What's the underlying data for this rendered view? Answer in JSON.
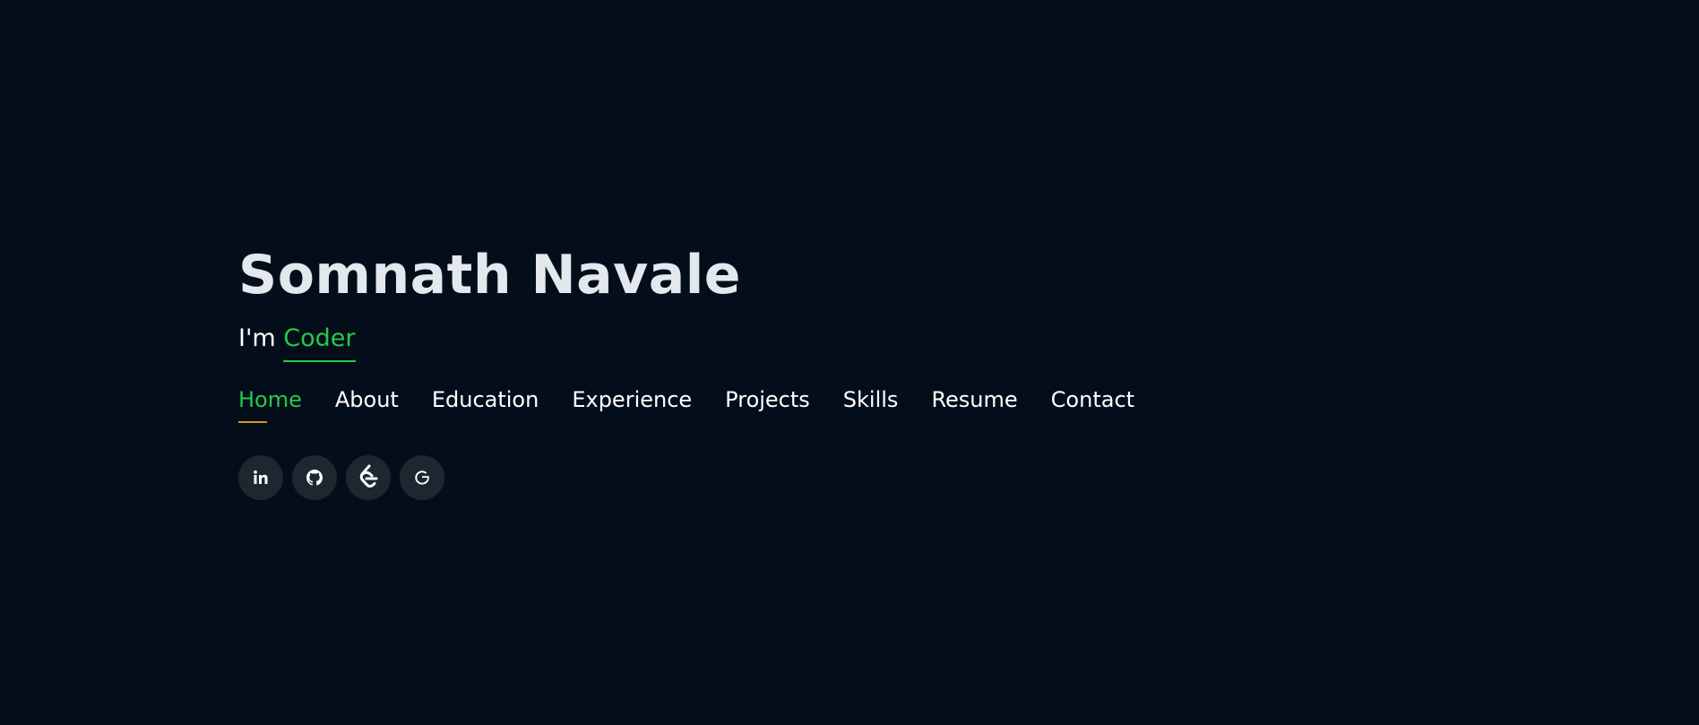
{
  "hero": {
    "name": "Somnath Navale",
    "intro": "I'm",
    "role": "Coder"
  },
  "nav": {
    "items": [
      "Home",
      "About",
      "Education",
      "Experience",
      "Projects",
      "Skills",
      "Resume",
      "Contact"
    ],
    "active": "Home"
  },
  "socials": [
    {
      "icon": "linkedin-icon"
    },
    {
      "icon": "github-icon"
    },
    {
      "icon": "leetcode-icon"
    },
    {
      "icon": "google-icon"
    }
  ],
  "colors": {
    "background": "#040e1a",
    "accent": "#25c94a",
    "underline": "#d29a18",
    "icon_bg": "#1e2630"
  }
}
